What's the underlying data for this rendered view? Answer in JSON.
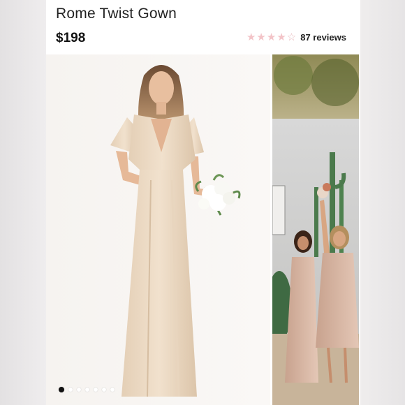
{
  "product": {
    "title": "Rome Twist Gown",
    "price": "$198",
    "rating": {
      "stars_filled": 4,
      "stars_total": 5,
      "reviews_label": "87 reviews"
    }
  },
  "gallery": {
    "slide_count": 7,
    "active_slide": 1
  },
  "colors": {
    "star": "#f3c4c8",
    "dress": "#ead8c2",
    "background": "#ffffff"
  }
}
